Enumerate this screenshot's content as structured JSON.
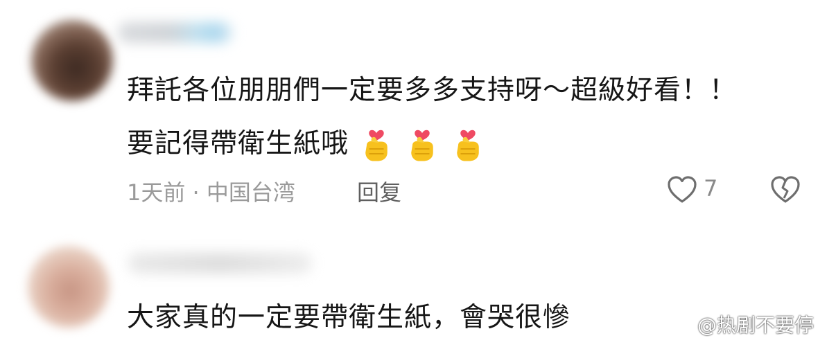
{
  "comments": [
    {
      "text_line1": "拜託各位朋朋們一定要多多支持呀～超級好看！！",
      "text_line2": "要記得帶衛生紙哦",
      "emojis": [
        "finger-heart-emoji",
        "finger-heart-emoji",
        "finger-heart-emoji"
      ],
      "meta": "1天前 · 中国台湾",
      "reply_label": "回复",
      "likes": "7"
    },
    {
      "text_line1": "大家真的一定要帶衛生紙，會哭很慘"
    }
  ],
  "watermark": {
    "icon": "weibo-logo",
    "text": "@热剧不要停"
  },
  "colors": {
    "text": "#161616",
    "meta": "#9a9a9a",
    "reply": "#5f5f5f",
    "icon_stroke": "#6e6e6e"
  }
}
